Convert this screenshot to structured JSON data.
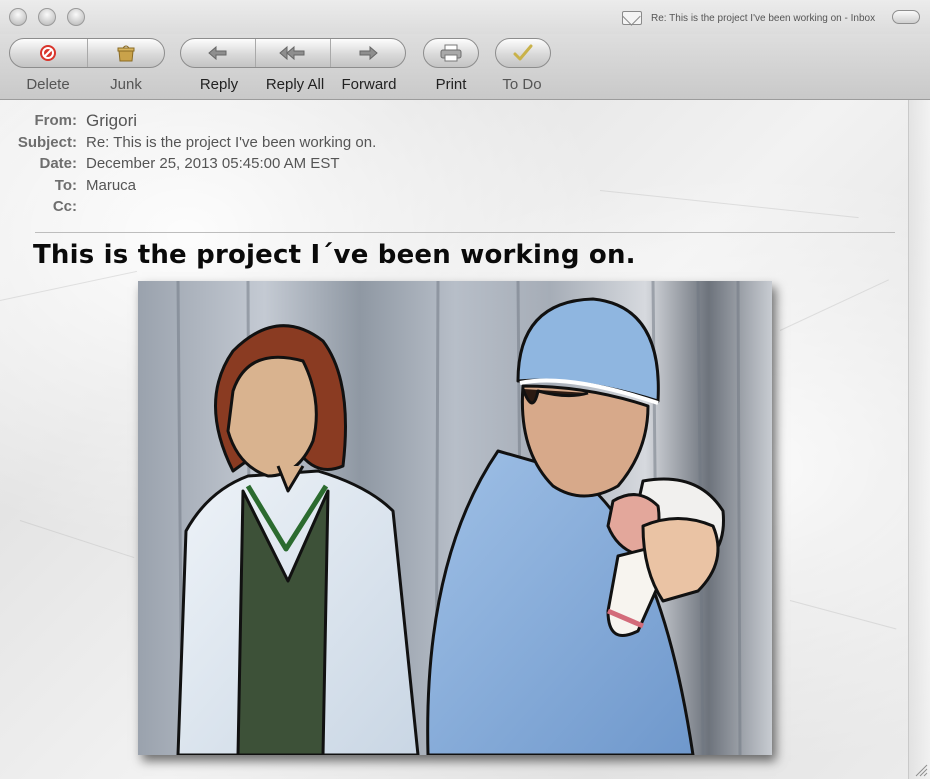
{
  "window": {
    "title": "Re: This is the project I've been working on - Inbox"
  },
  "toolbar": {
    "buttons": [
      {
        "label": "Delete",
        "icon": "delete-icon"
      },
      {
        "label": "Junk",
        "icon": "junk-icon"
      },
      {
        "label": "Reply",
        "icon": "reply-icon"
      },
      {
        "label": "Reply All",
        "icon": "reply-all-icon"
      },
      {
        "label": "Forward",
        "icon": "forward-icon"
      },
      {
        "label": "Print",
        "icon": "print-icon"
      },
      {
        "label": "To Do",
        "icon": "todo-check-icon"
      }
    ]
  },
  "headers": {
    "from_label": "From:",
    "from_value": "Grigori",
    "subject_label": "Subject:",
    "subject_value": "Re: This is the project I've been working on.",
    "date_label": "Date:",
    "date_value": "December 25, 2013 05:45:00 AM EST",
    "to_label": "To:",
    "to_value": "Maruca",
    "cc_label": "Cc:",
    "cc_value": ""
  },
  "message": {
    "heading": "This is the project I´ve been working on."
  },
  "colors": {
    "delete_red": "#d9342b",
    "junk_gold": "#c9a24a",
    "todo_green": "#6f9b2e",
    "scrubs_blue": "#7fa8d8",
    "hair_auburn": "#8a3b22"
  }
}
